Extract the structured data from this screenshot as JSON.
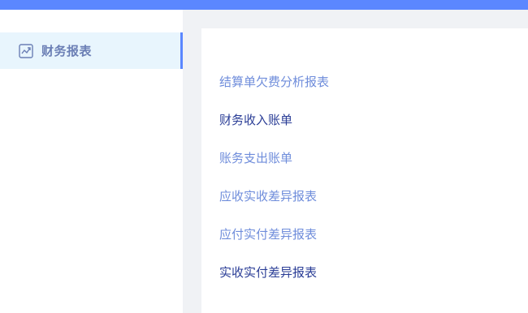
{
  "colors": {
    "topbar": "#5b87ff",
    "sidebar_active_bg": "#e8f5fd",
    "sidebar_active_border": "#5b87ff",
    "link_light": "#6f8ddb",
    "link_dark": "#2a3d96"
  },
  "sidebar": {
    "items": [
      {
        "label": "财务报表",
        "icon": "chart-trend-icon",
        "active": true
      }
    ]
  },
  "main": {
    "links": [
      {
        "label": "结算单欠费分析报表",
        "style": "light"
      },
      {
        "label": "财务收入账单",
        "style": "dark"
      },
      {
        "label": "账务支出账单",
        "style": "light"
      },
      {
        "label": "应收实收差异报表",
        "style": "light"
      },
      {
        "label": "应付实付差异报表",
        "style": "light"
      },
      {
        "label": "实收实付差异报表",
        "style": "dark"
      }
    ]
  }
}
